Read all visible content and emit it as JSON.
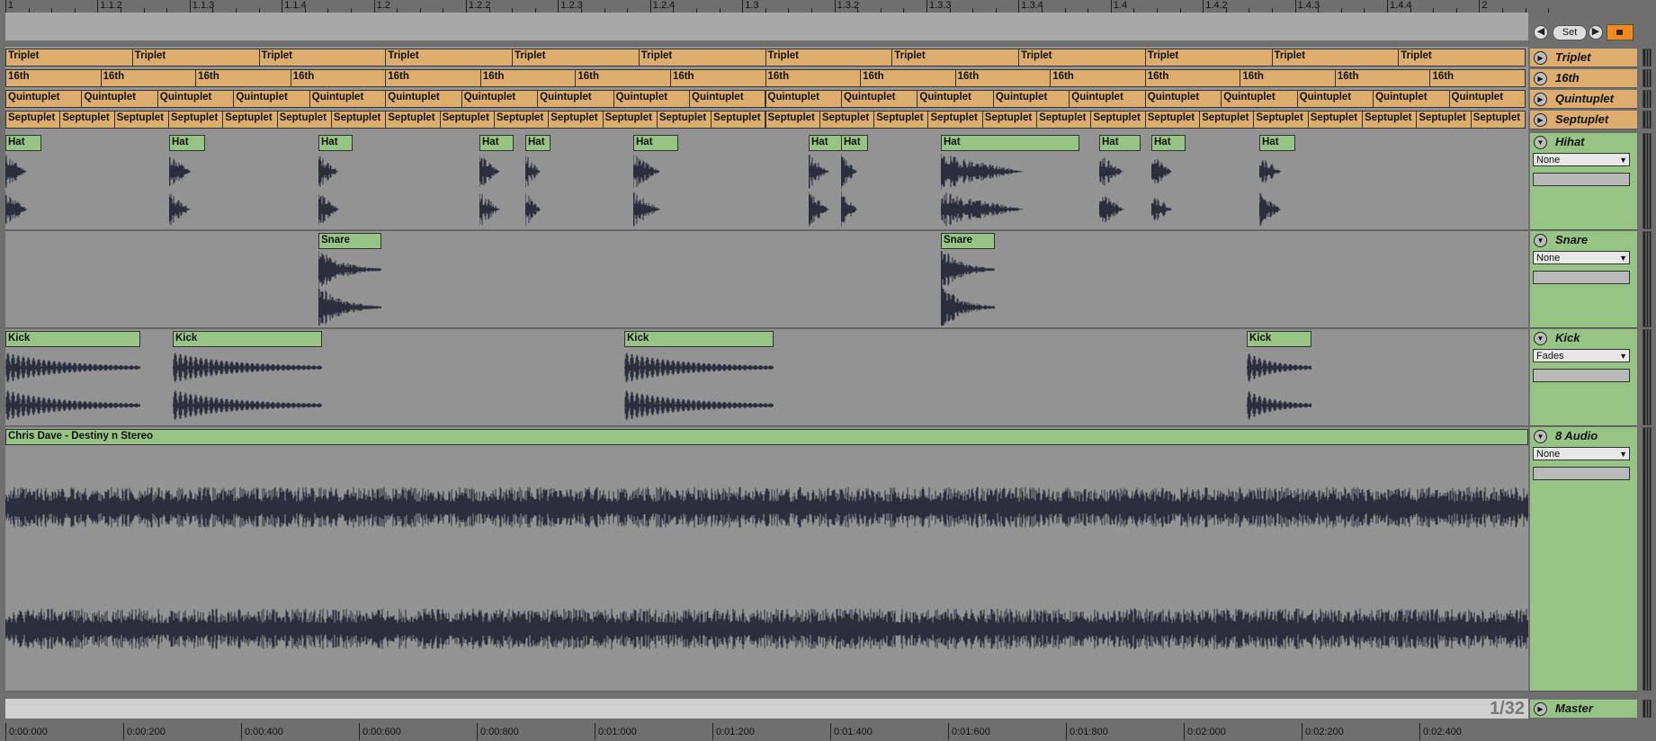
{
  "ruler": {
    "bars": [
      "1",
      "1.1.2",
      "1.1.3",
      "1.1.4",
      "1.2",
      "1.2.2",
      "1.2.3",
      "1.2.4",
      "1.3",
      "1.3.2",
      "1.3.3",
      "1.3.4",
      "1.4",
      "1.4.2",
      "1.4.3",
      "1.4.4",
      "2"
    ]
  },
  "controls": {
    "set_label": "Set",
    "back_icon": "arrow-left-icon",
    "fwd_icon": "arrow-right-icon",
    "lock_icon": "lock-icon"
  },
  "locators": [
    {
      "name": "Triplet",
      "count": 12
    },
    {
      "name": "16th",
      "count": 16
    },
    {
      "name": "Quintuplet",
      "count": 20
    },
    {
      "name": "Septuplet",
      "count": 28
    }
  ],
  "tracks": [
    {
      "name": "Hihat",
      "device": "None",
      "clip_label": "Hat"
    },
    {
      "name": "Snare",
      "device": "None",
      "clip_label": "Snare"
    },
    {
      "name": "Kick",
      "device": "Fades",
      "clip_label": "Kick"
    },
    {
      "name": "8 Audio",
      "device": "None",
      "clip_label": "Chris Dave - Destiny n Stereo"
    }
  ],
  "master": {
    "name": "Master"
  },
  "zoom": "1/32",
  "time_ruler": [
    "0:00:000",
    "0:00:200",
    "0:00:400",
    "0:00:600",
    "0:00:800",
    "0:01:000",
    "0:01:200",
    "0:01:400",
    "0:01:600",
    "0:01:800",
    "0:02:000",
    "0:02:200",
    "0:02:400"
  ],
  "colors": {
    "locator": "#dcad6d",
    "clip": "#96c485",
    "lock": "#f08a24",
    "background": "#939393"
  }
}
